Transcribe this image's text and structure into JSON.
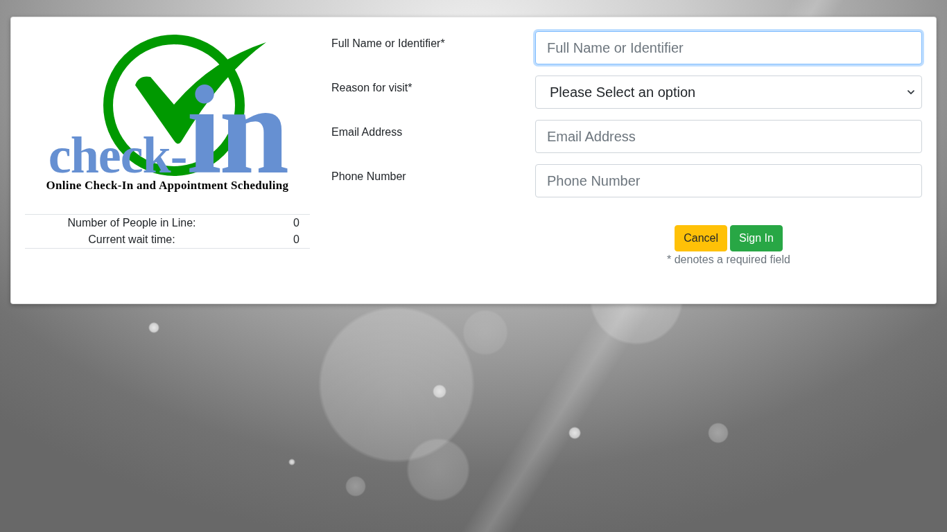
{
  "logo": {
    "wordmark": [
      "check-",
      "in"
    ],
    "tagline": "Online Check-In and Appointment Scheduling"
  },
  "queue_stats": [
    {
      "label": "Number of People in Line:",
      "value": "0"
    },
    {
      "label": "Current wait time:",
      "value": "0"
    }
  ],
  "form": {
    "fields": [
      {
        "kind": "text",
        "label": "Full Name or Identifier*",
        "placeholder": "Full Name or Identifier",
        "focused": true
      },
      {
        "kind": "select",
        "label": "Reason for visit*",
        "value": "Please Select an option",
        "focused": false
      },
      {
        "kind": "text",
        "label": "Email Address",
        "placeholder": "Email Address",
        "focused": false
      },
      {
        "kind": "text",
        "label": "Phone Number",
        "placeholder": "Phone Number",
        "focused": false
      }
    ],
    "buttons": [
      {
        "kind": "cancel",
        "label": "Cancel"
      },
      {
        "kind": "submit",
        "label": "Sign In"
      }
    ],
    "note": "* denotes a required field"
  }
}
